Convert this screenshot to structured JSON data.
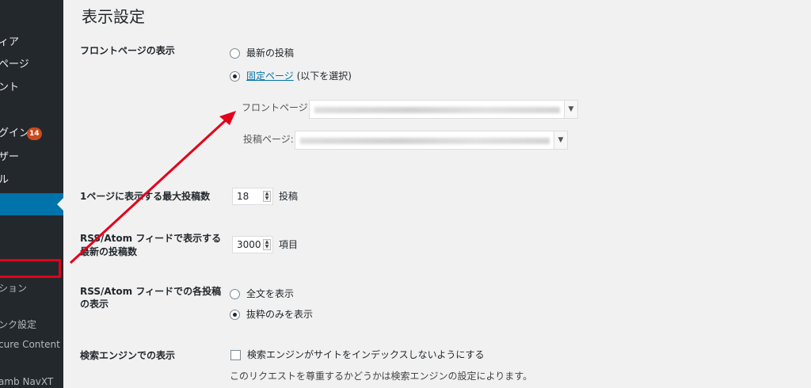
{
  "sidebar": {
    "items": [
      {
        "label": "ィア"
      },
      {
        "label": "ページ"
      },
      {
        "label": "ント"
      },
      {
        "label": "グイン",
        "badge": "14"
      },
      {
        "label": "ザー"
      },
      {
        "label": "ル"
      },
      {
        "label": ""
      },
      {
        "label": "ション"
      },
      {
        "label": "ンク設定"
      },
      {
        "label": "cure Content"
      },
      {
        "label": "amb NavXT"
      }
    ]
  },
  "page": {
    "title": "表示設定"
  },
  "front_page": {
    "label": "フロントページの表示",
    "opt_latest": "最新の投稿",
    "opt_static_link": "固定ページ",
    "opt_static_rest": " (以下を選択)",
    "front_select_label": "フロントページ:",
    "posts_select_label": "投稿ページ:"
  },
  "posts_per_page": {
    "label": "1ページに表示する最大投稿数",
    "value": "18",
    "unit": "投稿"
  },
  "rss_count": {
    "label_line1": "RSS/Atom フィードで表示する",
    "label_line2": "最新の投稿数",
    "value": "3000",
    "unit": "項目"
  },
  "rss_display": {
    "label_line1": "RSS/Atom フィードでの各投稿",
    "label_line2": "の表示",
    "opt_full": "全文を表示",
    "opt_summary": "抜粋のみを表示"
  },
  "search_engine": {
    "label": "検索エンジンでの表示",
    "checkbox_label": "検索エンジンがサイトをインデックスしないようにする",
    "description": "このリクエストを尊重するかどうかは検索エンジンの設定によります。"
  },
  "colors": {
    "sidebar_bg": "#23282d",
    "active": "#0073aa",
    "highlight": "#e2001a",
    "badge": "#ca4a1f"
  },
  "icons": {
    "dropdown": "chevron-down-icon",
    "spinner": "spinner-arrows-icon"
  }
}
